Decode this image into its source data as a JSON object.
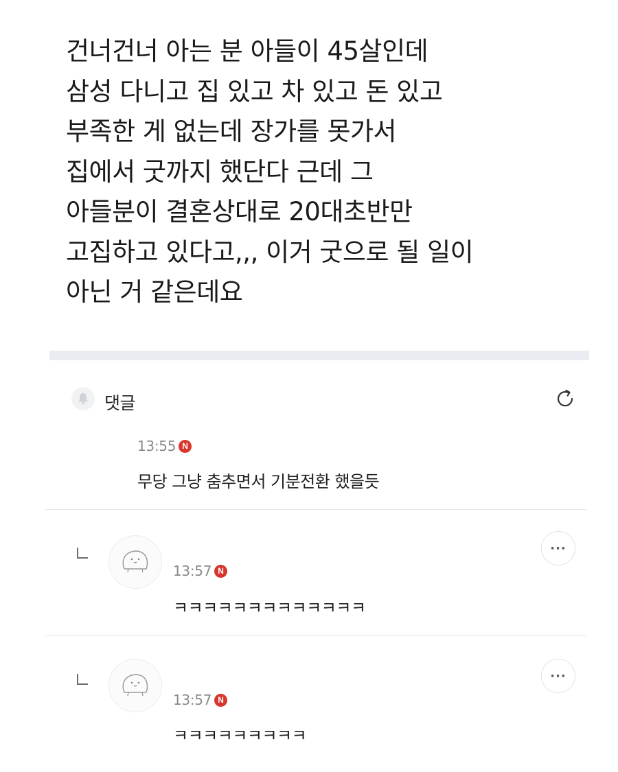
{
  "post": {
    "lines": [
      "건너건너 아는 분 아들이 45살인데",
      "삼성 다니고 집 있고 차 있고 돈 있고",
      "부족한 게 없는데 장가를 못가서",
      "집에서 굿까지 했단다 근데 그",
      "아들분이 결혼상대로 20대초반만",
      "고집하고 있다고,,, 이거 굿으로 될 일이",
      "아닌 거 같은데요"
    ]
  },
  "comments_section": {
    "title": "댓글",
    "bell_icon": "bell-icon",
    "refresh_icon": "refresh-icon"
  },
  "comments": [
    {
      "time": "13:55",
      "badge": "N",
      "text": "무당 그냥 춤추면서 기분전환 했을듯"
    },
    {
      "time": "13:57",
      "badge": "N",
      "text": "ㅋㅋㅋㅋㅋㅋㅋㅋㅋㅋㅋㅋㅋ",
      "is_reply": true,
      "more_label": "···"
    },
    {
      "time": "13:57",
      "badge": "N",
      "text": "ㅋㅋㅋㅋㅋㅋㅋㅋㅋ",
      "is_reply": true,
      "more_label": "···"
    }
  ],
  "colors": {
    "badge": "#d8352f",
    "divider": "#e9ecf1",
    "time_text": "#8a8a8a"
  }
}
